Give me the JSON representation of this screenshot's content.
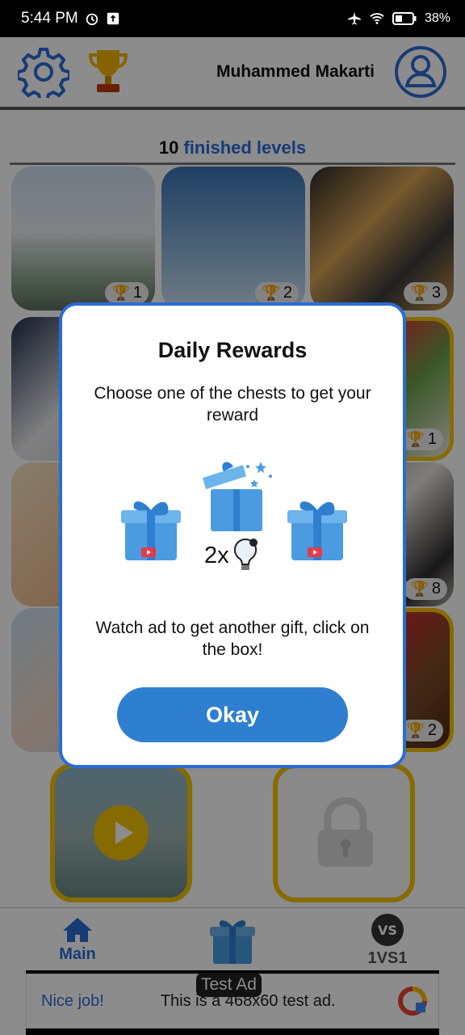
{
  "status_bar": {
    "time": "5:44 PM",
    "battery": "38%"
  },
  "header": {
    "user_name": "Muhammed Makarti"
  },
  "levels": {
    "count": "10",
    "label": "finished levels"
  },
  "tiles": [
    {
      "trophies": "1"
    },
    {
      "trophies": "2"
    },
    {
      "trophies": "3"
    },
    {
      "trophies": "1"
    },
    {
      "trophies": "8"
    },
    {
      "trophies": "2"
    }
  ],
  "bottom_nav": {
    "main_label": "Main",
    "vs_label": "1VS1"
  },
  "ad": {
    "badge": "Test Ad",
    "nice": "Nice job!",
    "text": "This is a 468x60 test ad."
  },
  "dialog": {
    "title": "Daily Rewards",
    "description": "Choose one of the chests to get your reward",
    "bonus": "2x",
    "watch_text": "Watch ad to get another gift, click on the box!",
    "ok_label": "Okay"
  },
  "colors": {
    "accent": "#2a6cd6",
    "gold": "#f4c400",
    "button": "#2f7fd0"
  },
  "icons": [
    "gear-icon",
    "trophy-icon",
    "profile-icon",
    "home-icon",
    "gift-icon",
    "vs-icon",
    "lightbulb-icon",
    "video-icon"
  ]
}
